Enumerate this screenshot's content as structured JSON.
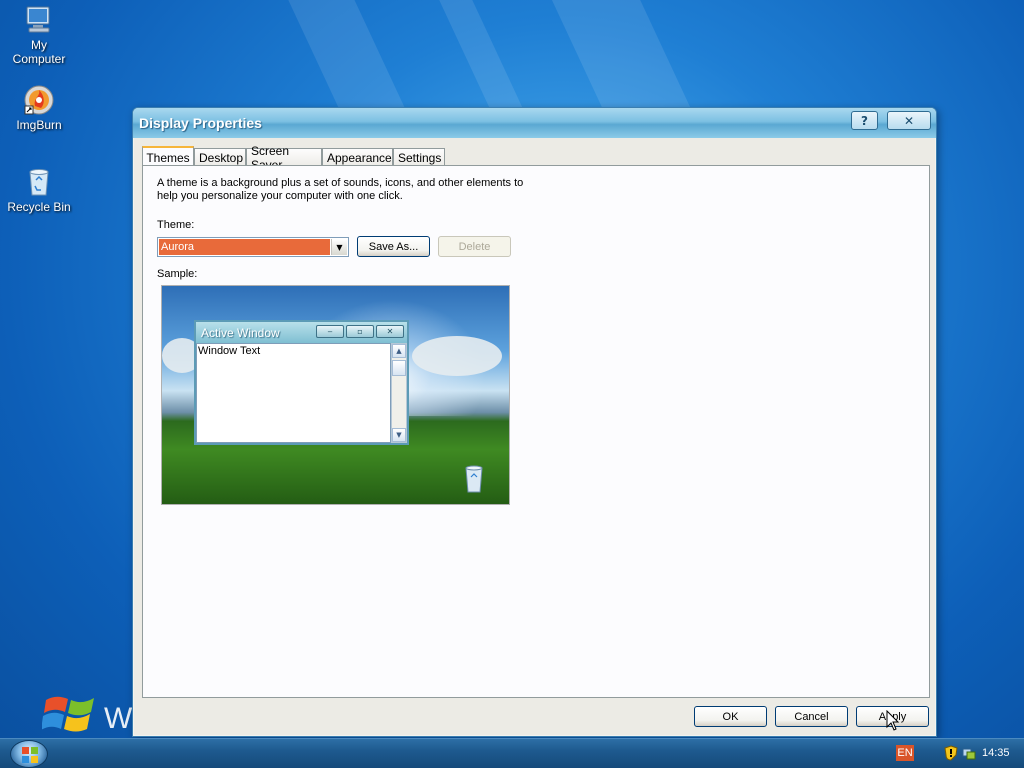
{
  "desktop": {
    "icons": [
      {
        "label": "My\nComputer",
        "icon": "computer-icon"
      },
      {
        "label": "ImgBurn",
        "icon": "imgburn-icon"
      },
      {
        "label": "Recycle Bin",
        "icon": "recycle-bin-icon"
      }
    ],
    "logo_text": "W"
  },
  "dialog": {
    "title": "Display Properties",
    "help_label": "?",
    "close_label": "✕",
    "tabs": [
      {
        "label": "Themes",
        "active": true
      },
      {
        "label": "Desktop",
        "active": false
      },
      {
        "label": "Screen Saver",
        "active": false
      },
      {
        "label": "Appearance",
        "active": false
      },
      {
        "label": "Settings",
        "active": false
      }
    ],
    "themes": {
      "description": "A theme is a background plus a set of sounds, icons, and other elements to help you personalize your computer with one click.",
      "theme_label": "Theme:",
      "theme_value": "Aurora",
      "save_as_label": "Save As...",
      "delete_label": "Delete",
      "sample_label": "Sample:",
      "sample": {
        "window_title": "Active Window",
        "window_text": "Window Text"
      }
    },
    "footer": {
      "ok_label": "OK",
      "cancel_label": "Cancel",
      "apply_label": "Apply"
    }
  },
  "taskbar": {
    "language": "EN",
    "clock": "14:35"
  },
  "colors": {
    "selection": "#e86a3a",
    "titlebar": "#7cc0e2",
    "taskbar": "#1e5a8f"
  }
}
